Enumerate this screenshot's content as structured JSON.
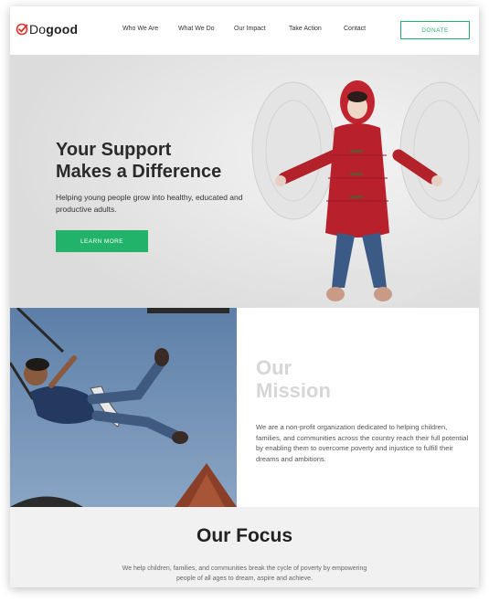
{
  "header": {
    "logo_text_plain": "Do",
    "logo_text_bold": "good",
    "nav": [
      "Who We Are",
      "What We Do",
      "Our Impact",
      "Take Action",
      "Contact"
    ],
    "donate_label": "DONATE"
  },
  "hero": {
    "title_line1": "Your Support",
    "title_line2": "Makes a Difference",
    "subtitle": "Helping young people grow into healthy, educated and productive adults.",
    "button_label": "LEARN MORE"
  },
  "mission": {
    "title_line1": "Our",
    "title_line2": "Mission",
    "text": "We are a non-profit organization dedicated to helping children, families, and communities across the country reach their full potential by enabling them to overcome poverty and injustice to fulfill their dreams and ambitions."
  },
  "focus": {
    "title": "Our Focus",
    "text": "We help children, families, and communities break the cycle of poverty by empowering people of all ages to dream, aspire and achieve."
  },
  "colors": {
    "accent": "#22b36a",
    "logo_red": "#d9332a"
  }
}
